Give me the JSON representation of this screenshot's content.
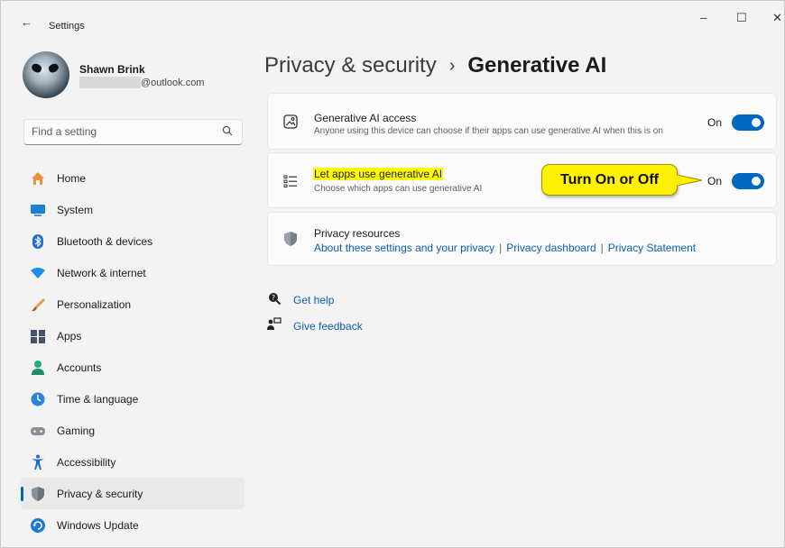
{
  "window": {
    "title": "Settings",
    "controls": {
      "minimize": "–",
      "maximize": "☐",
      "close": "✕"
    }
  },
  "profile": {
    "name": "Shawn Brink",
    "email_suffix": "@outlook.com"
  },
  "search": {
    "placeholder": "Find a setting"
  },
  "sidebar": {
    "items": [
      {
        "label": "Home",
        "icon": "home-icon",
        "selected": false
      },
      {
        "label": "System",
        "icon": "system-icon",
        "selected": false
      },
      {
        "label": "Bluetooth & devices",
        "icon": "bluetooth-icon",
        "selected": false
      },
      {
        "label": "Network & internet",
        "icon": "network-icon",
        "selected": false
      },
      {
        "label": "Personalization",
        "icon": "brush-icon",
        "selected": false
      },
      {
        "label": "Apps",
        "icon": "apps-icon",
        "selected": false
      },
      {
        "label": "Accounts",
        "icon": "accounts-icon",
        "selected": false
      },
      {
        "label": "Time & language",
        "icon": "time-language-icon",
        "selected": false
      },
      {
        "label": "Gaming",
        "icon": "gaming-icon",
        "selected": false
      },
      {
        "label": "Accessibility",
        "icon": "accessibility-icon",
        "selected": false
      },
      {
        "label": "Privacy & security",
        "icon": "shield-icon",
        "selected": true
      },
      {
        "label": "Windows Update",
        "icon": "windows-update-icon",
        "selected": false
      }
    ]
  },
  "breadcrumb": {
    "parent": "Privacy & security",
    "separator": "›",
    "current": "Generative AI"
  },
  "cards": {
    "access": {
      "title": "Generative AI access",
      "description": "Anyone using this device can choose if their apps can use generative AI when this is on",
      "toggle_label": "On",
      "toggle_on": true
    },
    "apps": {
      "title": "Let apps use generative AI",
      "description": "Choose which apps can use generative AI",
      "toggle_label": "On",
      "toggle_on": true
    },
    "resources": {
      "title": "Privacy resources",
      "links": [
        "About these settings and your privacy",
        "Privacy dashboard",
        "Privacy Statement"
      ],
      "separator": "|"
    }
  },
  "callout": {
    "text": "Turn On or Off"
  },
  "help": {
    "get_help": "Get help",
    "give_feedback": "Give feedback"
  },
  "colors": {
    "accent": "#0067c0",
    "link": "#0b5fb0",
    "highlight": "#ffff00",
    "callout": "#fff200"
  }
}
